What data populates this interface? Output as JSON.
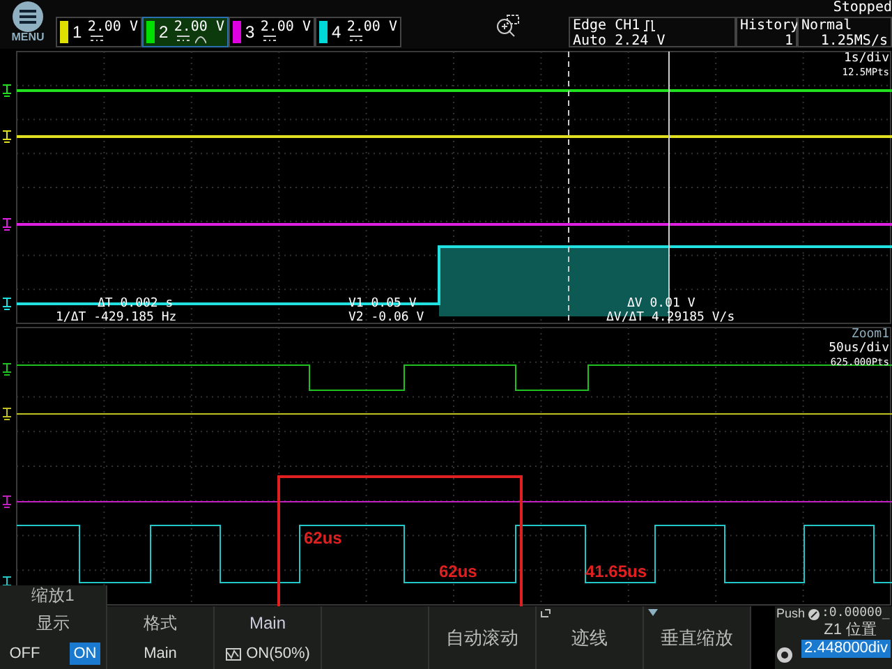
{
  "menu": {
    "label": "MENU"
  },
  "channels": [
    {
      "number": "1",
      "volts": "2.00 V",
      "color": "#e0e000",
      "selected": false,
      "bandwidth_limit": false
    },
    {
      "number": "2",
      "volts": "2.00 V",
      "color": "#00e000",
      "selected": true,
      "bandwidth_limit": true
    },
    {
      "number": "3",
      "volts": "2.00 V",
      "color": "#e000e0",
      "selected": false,
      "bandwidth_limit": false
    },
    {
      "number": "4",
      "volts": "2.00 V",
      "color": "#00d8d8",
      "selected": false,
      "bandwidth_limit": false
    }
  ],
  "status": "Stopped",
  "trigger": {
    "line1": "Edge CH1",
    "line2": "Auto 2.24 V"
  },
  "history": {
    "label": "History",
    "value": "1"
  },
  "acquisition": {
    "mode": "Normal",
    "rate": "1.25MS/s"
  },
  "main_view": {
    "timebase": "1s/div",
    "points": "12.5MPts",
    "cursor_readouts": [
      {
        "label": "ΔT",
        "value": "0.002 s"
      },
      {
        "label": "V1",
        "value": "0.05 V"
      },
      {
        "label": "ΔV",
        "value": "0.01 V"
      },
      {
        "label": "1/ΔT",
        "value": "-429.185 Hz"
      },
      {
        "label": "V2",
        "value": "-0.06 V"
      },
      {
        "label": "ΔV/ΔT",
        "value": "4.29185 V/s"
      }
    ]
  },
  "zoom_view": {
    "title": "Zoom1",
    "timebase": "50us/div",
    "points": "625.000Pts",
    "annotations": [
      "62us",
      "62us",
      "41.65us"
    ]
  },
  "menu_tab": "缩放1",
  "softkeys": [
    {
      "kind": "toggle",
      "title": "显示",
      "options": [
        {
          "label": "OFF",
          "selected": false
        },
        {
          "label": "ON",
          "selected": true
        }
      ]
    },
    {
      "kind": "value",
      "title": "格式",
      "value": "Main"
    },
    {
      "kind": "icon_value",
      "title": "Main",
      "value": "ON(50%)"
    },
    {
      "kind": "spacer"
    },
    {
      "kind": "label",
      "label": "自动滚动"
    },
    {
      "kind": "submenu",
      "label": "迹线"
    },
    {
      "kind": "dropdown",
      "label": "垂直缩放"
    }
  ],
  "knob": {
    "push": "Push",
    "push_value": ":0.00000_",
    "title": "Z1 位置",
    "value": "2.448000div"
  }
}
